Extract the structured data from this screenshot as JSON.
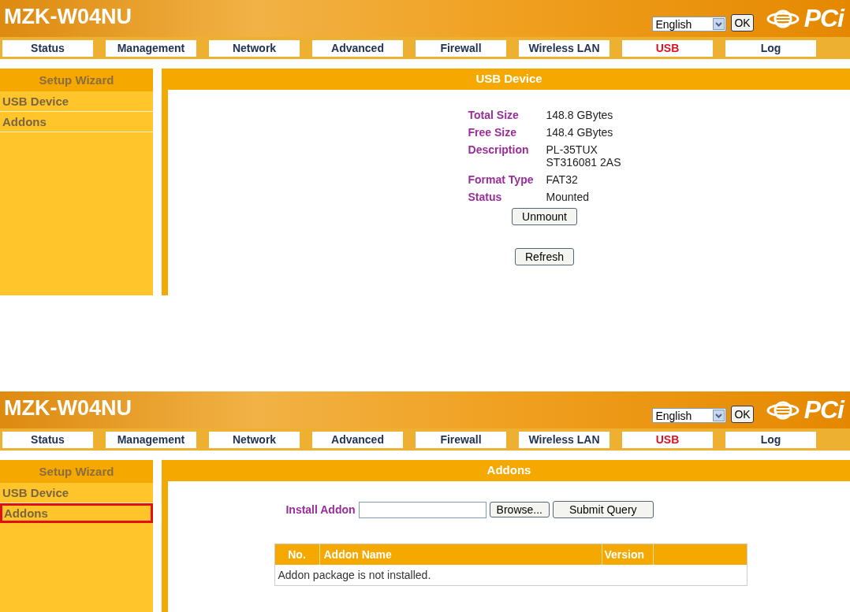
{
  "screens": [
    {
      "kind": "device",
      "header": {
        "title": "MZK-W04NU",
        "language": "English",
        "ok": "OK",
        "logo": "PCi"
      },
      "tabs": [
        {
          "label": "Status",
          "selected": false
        },
        {
          "label": "Management",
          "selected": false
        },
        {
          "label": "Network",
          "selected": false
        },
        {
          "label": "Advanced",
          "selected": false
        },
        {
          "label": "Firewall",
          "selected": false
        },
        {
          "label": "Wireless LAN",
          "selected": false
        },
        {
          "label": "USB",
          "selected": true
        },
        {
          "label": "Log",
          "selected": false
        }
      ],
      "sidebar": {
        "title": "Setup Wizard",
        "items": [
          {
            "label": "USB Device",
            "highlighted": false
          },
          {
            "label": "Addons",
            "highlighted": false
          }
        ]
      },
      "content": {
        "title": "USB Device",
        "fields": [
          {
            "label": "Total Size",
            "value": [
              "148.8 GBytes"
            ]
          },
          {
            "label": "Free Size",
            "value": [
              "148.4 GBytes"
            ]
          },
          {
            "label": "Description",
            "value": [
              "PL-35TUX",
              "ST316081 2AS"
            ]
          },
          {
            "label": "Format Type",
            "value": [
              "FAT32"
            ]
          },
          {
            "label": "Status",
            "value": [
              "Mounted"
            ]
          }
        ],
        "buttons": [
          "Unmount",
          "Refresh"
        ]
      }
    },
    {
      "kind": "addons",
      "header": {
        "title": "MZK-W04NU",
        "language": "English",
        "ok": "OK",
        "logo": "PCi"
      },
      "tabs": [
        {
          "label": "Status",
          "selected": false
        },
        {
          "label": "Management",
          "selected": false
        },
        {
          "label": "Network",
          "selected": false
        },
        {
          "label": "Advanced",
          "selected": false
        },
        {
          "label": "Firewall",
          "selected": false
        },
        {
          "label": "Wireless LAN",
          "selected": false
        },
        {
          "label": "USB",
          "selected": true
        },
        {
          "label": "Log",
          "selected": false
        }
      ],
      "sidebar": {
        "title": "Setup Wizard",
        "items": [
          {
            "label": "USB Device",
            "highlighted": false
          },
          {
            "label": "Addons",
            "highlighted": true
          }
        ]
      },
      "content": {
        "title": "Addons",
        "install_label": "Install Addon",
        "browse": "Browse...",
        "submit": "Submit Query",
        "columns": [
          "No.",
          "Addon Name",
          "Version"
        ],
        "empty_message": "Addon package is not installed."
      }
    }
  ]
}
